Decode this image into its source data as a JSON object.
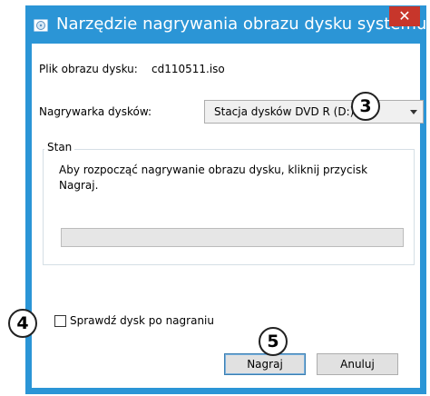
{
  "window": {
    "title": "Narzędzie nagrywania obrazu dysku systemu ...",
    "close_glyph": "✕",
    "title_icon": "disc-burner-icon"
  },
  "dialog": {
    "image_label": "Plik obrazu dysku:",
    "image_value": "cd110511.iso",
    "burner_label": "Nagrywarka dysków:",
    "burner_value": "Stacja dysków DVD R (D:)",
    "status_group_title": "Stan",
    "status_message": "Aby rozpocząć nagrywanie obrazu dysku, kliknij przycisk Nagraj.",
    "progress_fraction": 0,
    "verify_label": "Sprawdź dysk po nagraniu",
    "verify_checked": false,
    "burn_button": "Nagraj",
    "cancel_button": "Anuluj"
  },
  "annotations": {
    "badge_3": "3",
    "badge_4": "4",
    "badge_5": "5"
  },
  "colors": {
    "accent": "#2b95d6",
    "close": "#c7362b"
  }
}
